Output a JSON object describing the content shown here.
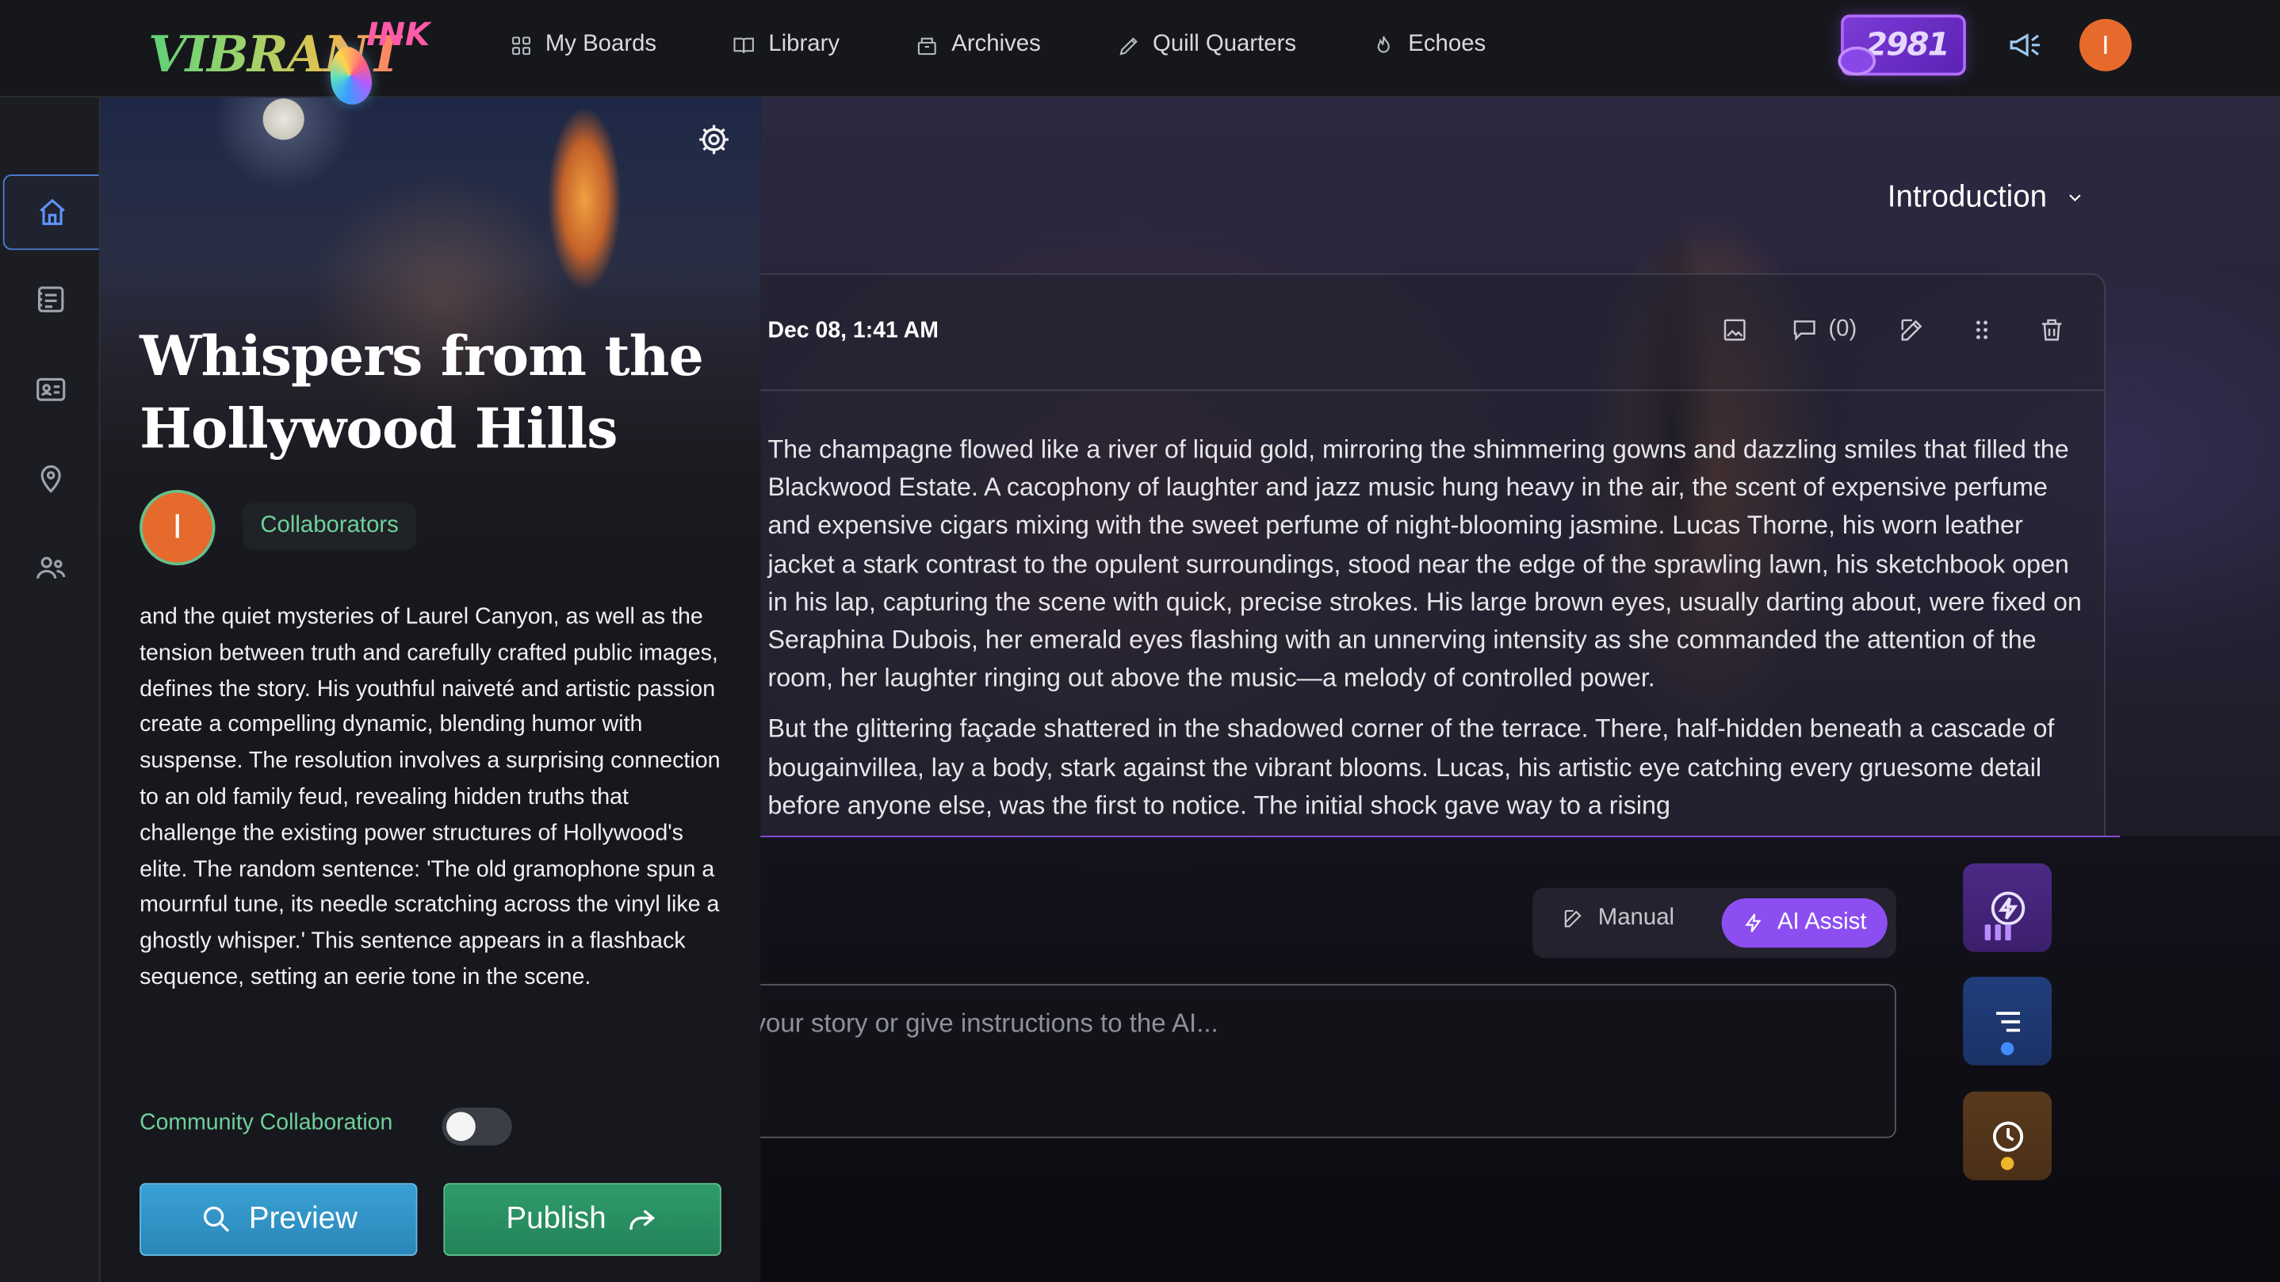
{
  "app": {
    "logo_text": "VIBRANT",
    "logo_sub": "INK"
  },
  "nav": {
    "items": [
      {
        "label": "My Boards",
        "icon": "grid-icon"
      },
      {
        "label": "Library",
        "icon": "book-icon"
      },
      {
        "label": "Archives",
        "icon": "archive-icon"
      },
      {
        "label": "Quill Quarters",
        "icon": "pencil-icon"
      },
      {
        "label": "Echoes",
        "icon": "flame-icon"
      }
    ],
    "points": "2981",
    "user_initial": "I"
  },
  "rail": {
    "items": [
      {
        "name": "home",
        "icon": "home-icon",
        "active": true
      },
      {
        "name": "chapters",
        "icon": "notebook-icon",
        "active": false
      },
      {
        "name": "characters",
        "icon": "id-card-icon",
        "active": false
      },
      {
        "name": "locations",
        "icon": "map-pin-icon",
        "active": false
      },
      {
        "name": "collaborators",
        "icon": "users-icon",
        "active": false
      }
    ]
  },
  "story": {
    "title": "Whispers from the Hollywood Hills",
    "author_initial": "I",
    "collaborators_label": "Collaborators",
    "synopsis": "and the quiet mysteries of Laurel Canyon, as well as the tension between truth and carefully crafted public images, defines the story. His youthful naiveté and artistic passion create a compelling dynamic, blending humor with suspense. The resolution involves a surprising connection to an old family feud, revealing hidden truths that challenge the existing power structures of Hollywood's elite. The random sentence: 'The old gramophone spun a mournful tune, its needle scratching across the vinyl like a ghostly whisper.' This sentence appears in a flashback sequence, setting an eerie tone in the scene.",
    "community_label": "Community Collaboration",
    "community_enabled": false,
    "preview_label": "Preview",
    "publish_label": "Publish"
  },
  "chapter": {
    "selected": "Introduction"
  },
  "entry": {
    "date": "Dec 08, 1:41 AM",
    "comments_count": "(0)",
    "paragraphs": [
      "The champagne flowed like a river of liquid gold, mirroring the shimmering gowns and dazzling smiles that filled the Blackwood Estate. A cacophony of laughter and jazz music hung heavy in the air, the scent of expensive perfume and expensive cigars mixing with the sweet perfume of night-blooming jasmine. Lucas Thorne, his worn leather jacket a stark contrast to the opulent surroundings, stood near the edge of the sprawling lawn, his sketchbook open in his lap, capturing the scene with quick, precise strokes. His large brown eyes, usually darting about, were fixed on Seraphina Dubois, her emerald eyes flashing with an unnerving intensity as she commanded the attention of the room, her laughter ringing out above the music—a melody of controlled power.",
      "But the glittering façade shattered in the shadowed corner of the terrace. There, half-hidden beneath a cascade of bougainvillea, lay a body, stark against the vibrant blooms. Lucas, his artistic eye catching every gruesome detail before anyone else, was the first to notice. The initial shock gave way to a rising"
    ]
  },
  "composer": {
    "mode_manual": "Manual",
    "mode_ai": "AI Assist",
    "placeholder": "Write your story or give instructions to the AI..."
  },
  "colors": {
    "accent_purple": "#8c4ef0",
    "accent_green": "#6fd09a",
    "avatar_orange": "#e56a2c",
    "preview_blue": "#2a86b8",
    "publish_green": "#238258"
  }
}
